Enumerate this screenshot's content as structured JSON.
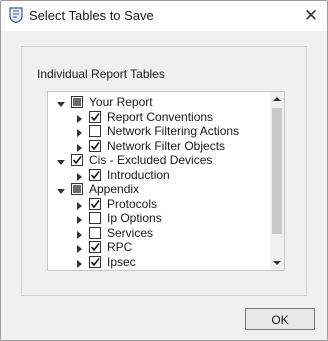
{
  "window": {
    "title": "Select Tables to Save",
    "icon": "shield-doc-icon",
    "close_icon": "close-icon"
  },
  "group": {
    "label": "Individual Report Tables"
  },
  "tree": {
    "items": [
      {
        "label": "Your Report",
        "level": 0,
        "expand": "down",
        "check": "partial"
      },
      {
        "label": "Report Conventions",
        "level": 1,
        "expand": "right",
        "check": "checked"
      },
      {
        "label": "Network Filtering Actions",
        "level": 1,
        "expand": "right",
        "check": "unchecked"
      },
      {
        "label": "Network Filter Objects",
        "level": 1,
        "expand": "right",
        "check": "checked"
      },
      {
        "label": "Cis - Excluded Devices",
        "level": 0,
        "expand": "down",
        "check": "checked"
      },
      {
        "label": "Introduction",
        "level": 1,
        "expand": "right",
        "check": "checked"
      },
      {
        "label": "Appendix",
        "level": 0,
        "expand": "down",
        "check": "partial"
      },
      {
        "label": "Protocols",
        "level": 1,
        "expand": "right",
        "check": "checked"
      },
      {
        "label": "Ip Options",
        "level": 1,
        "expand": "right",
        "check": "unchecked"
      },
      {
        "label": "Services",
        "level": 1,
        "expand": "right",
        "check": "unchecked"
      },
      {
        "label": "RPC",
        "level": 1,
        "expand": "right",
        "check": "checked"
      },
      {
        "label": "Ipsec",
        "level": 1,
        "expand": "right",
        "check": "checked"
      }
    ]
  },
  "buttons": {
    "ok_label": "OK"
  }
}
